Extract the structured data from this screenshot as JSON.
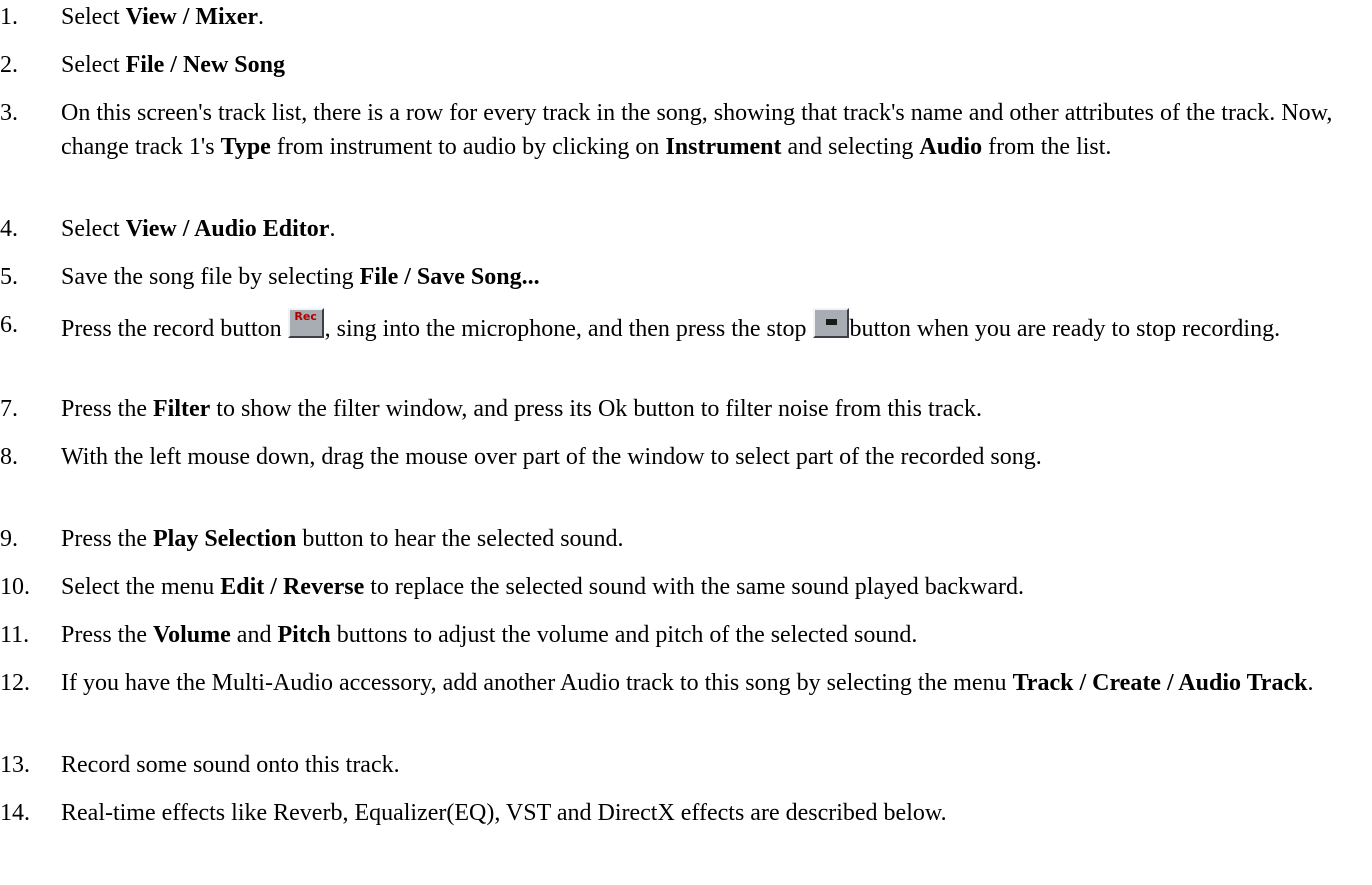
{
  "steps": [
    {
      "num": "1.",
      "parts": [
        {
          "t": "Select "
        },
        {
          "t": "View / Mixer",
          "b": true
        },
        {
          "t": "."
        }
      ]
    },
    {
      "num": "2.",
      "parts": [
        {
          "t": "Select "
        },
        {
          "t": "File / New Song",
          "b": true
        }
      ]
    },
    {
      "num": "3.",
      "parts": [
        {
          "t": "On this screen's track list, there is a row for every track in the song, showing that track's name and other attributes of the track. Now, change track 1's "
        },
        {
          "t": "Type",
          "b": true
        },
        {
          "t": " from instrument to audio by clicking on "
        },
        {
          "t": "Instrument",
          "b": true
        },
        {
          "t": " and selecting "
        },
        {
          "t": "Audio",
          "b": true
        },
        {
          "t": " from the list."
        }
      ]
    },
    {
      "num": "4.",
      "parts": [
        {
          "t": "Select "
        },
        {
          "t": "View / Audio Editor",
          "b": true
        },
        {
          "t": "."
        }
      ]
    },
    {
      "num": "5.",
      "parts": [
        {
          "t": "Save the song file by selecting "
        },
        {
          "t": "File / Save Song...",
          "b": true
        }
      ]
    },
    {
      "num": "6.",
      "parts": [
        {
          "t": "Press the record button "
        },
        {
          "icon": "rec",
          "label": "Rec"
        },
        {
          "t": ", sing into the microphone, and then press the stop "
        },
        {
          "icon": "stop"
        },
        {
          "t": "button when you are ready to stop recording."
        }
      ]
    },
    {
      "num": "7.",
      "parts": [
        {
          "t": "Press the "
        },
        {
          "t": "Filter",
          "b": true
        },
        {
          "t": " to show the filter window, and press its Ok button to filter noise from this track."
        }
      ]
    },
    {
      "num": "8.",
      "parts": [
        {
          "t": "With the left mouse down, drag the mouse over part of the window to select part of the recorded song."
        }
      ]
    },
    {
      "num": "9.",
      "parts": [
        {
          "t": "Press the "
        },
        {
          "t": "Play Selection",
          "b": true
        },
        {
          "t": " button to hear the selected sound."
        }
      ]
    },
    {
      "num": "10.",
      "parts": [
        {
          "t": "Select the menu "
        },
        {
          "t": "Edit / Reverse",
          "b": true
        },
        {
          "t": " to replace the selected sound with the same sound played backward."
        }
      ]
    },
    {
      "num": "11.",
      "parts": [
        {
          "t": "Press the "
        },
        {
          "t": "Volume",
          "b": true
        },
        {
          "t": " and "
        },
        {
          "t": "Pitch",
          "b": true
        },
        {
          "t": " buttons to adjust the volume and pitch of the selected sound."
        }
      ]
    },
    {
      "num": "12.",
      "parts": [
        {
          "t": "If you have the Multi-Audio accessory, add another Audio track to this song by selecting the menu "
        },
        {
          "t": "Track / Create / Audio Track",
          "b": true
        },
        {
          "t": "."
        }
      ]
    },
    {
      "num": "13.",
      "parts": [
        {
          "t": "Record some sound onto this track."
        }
      ]
    },
    {
      "num": "14.",
      "parts": [
        {
          "t": "Real-time effects like Reverb, Equalizer(EQ), VST and DirectX effects are described below."
        }
      ]
    }
  ]
}
